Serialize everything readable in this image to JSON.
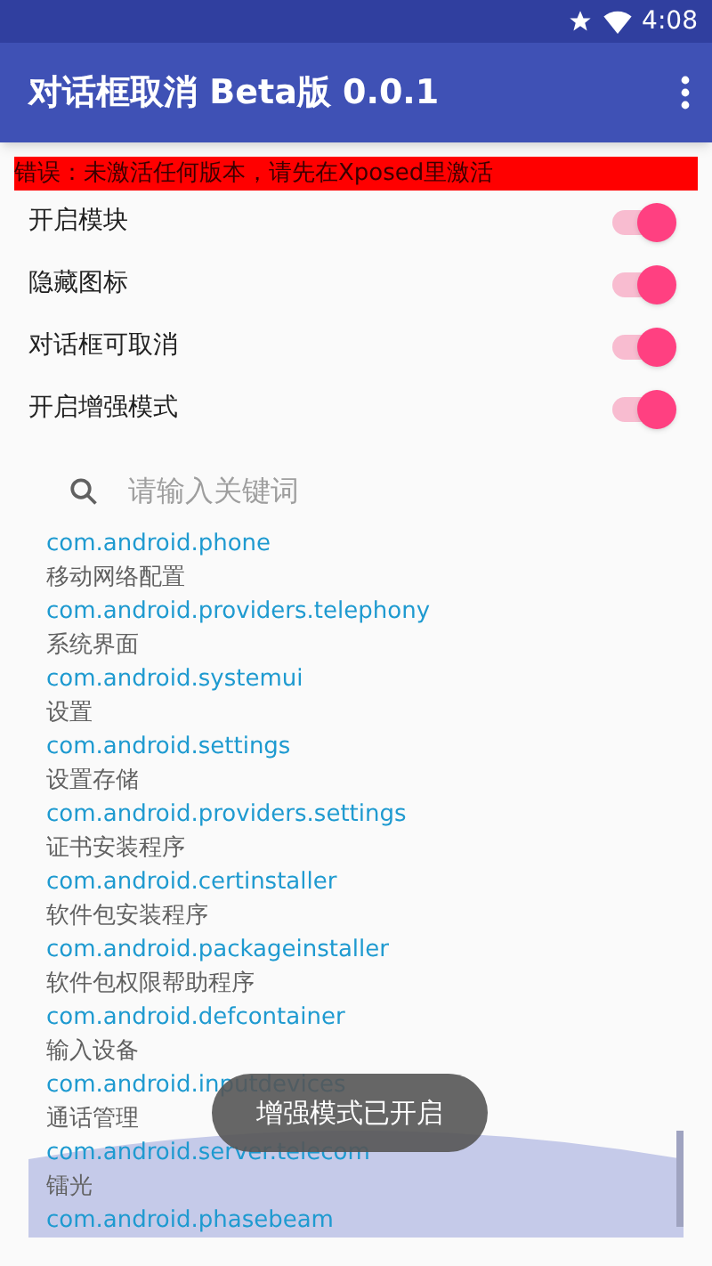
{
  "status_bar": {
    "time": "4:08"
  },
  "app_bar": {
    "title": "对话框取消 Beta版 0.0.1"
  },
  "error_banner": "错误：未激活任何版本，请先在Xposed里激活",
  "switches": [
    {
      "label": "开启模块",
      "on": true
    },
    {
      "label": "隐藏图标",
      "on": true
    },
    {
      "label": "对话框可取消",
      "on": true
    },
    {
      "label": "开启增强模式",
      "on": true
    }
  ],
  "search": {
    "placeholder": "请输入关键词"
  },
  "app_list": [
    {
      "kind": "package",
      "text": "com.android.phone"
    },
    {
      "kind": "label",
      "text": "移动网络配置"
    },
    {
      "kind": "package",
      "text": "com.android.providers.telephony"
    },
    {
      "kind": "label",
      "text": "系统界面"
    },
    {
      "kind": "package",
      "text": "com.android.systemui"
    },
    {
      "kind": "label",
      "text": "设置"
    },
    {
      "kind": "package",
      "text": "com.android.settings"
    },
    {
      "kind": "label",
      "text": "设置存储"
    },
    {
      "kind": "package",
      "text": "com.android.providers.settings"
    },
    {
      "kind": "label",
      "text": "证书安装程序"
    },
    {
      "kind": "package",
      "text": "com.android.certinstaller"
    },
    {
      "kind": "label",
      "text": "软件包安装程序"
    },
    {
      "kind": "package",
      "text": "com.android.packageinstaller"
    },
    {
      "kind": "label",
      "text": "软件包权限帮助程序"
    },
    {
      "kind": "package",
      "text": "com.android.defcontainer"
    },
    {
      "kind": "label",
      "text": "输入设备"
    },
    {
      "kind": "package",
      "text": "com.android.inputdevices"
    },
    {
      "kind": "label",
      "text": "通话管理"
    },
    {
      "kind": "package",
      "text": "com.android.server.telecom"
    },
    {
      "kind": "label",
      "text": "镭光"
    },
    {
      "kind": "package",
      "text": "com.android.phasebeam"
    }
  ],
  "toast": "增强模式已开启"
}
